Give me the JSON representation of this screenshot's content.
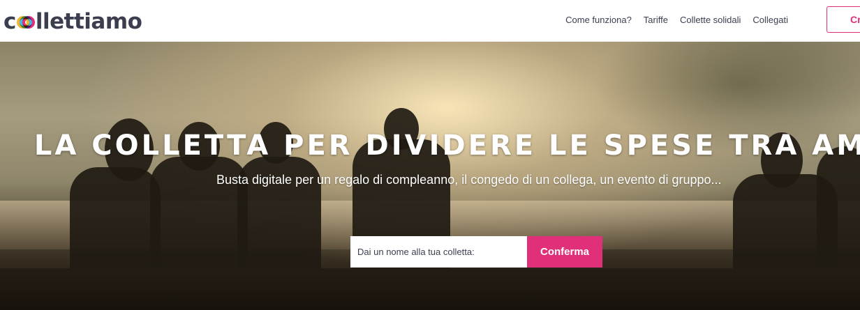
{
  "brand": {
    "logo_prefix": "c",
    "logo_suffix": "llettiamo",
    "accent_color": "#e0307a",
    "logo_ring_colors": [
      "#f2b632",
      "#e0307a",
      "#2ba6de"
    ]
  },
  "nav": {
    "items": [
      {
        "label": "Come funziona?"
      },
      {
        "label": "Tariffe"
      },
      {
        "label": "Collette solidali"
      },
      {
        "label": "Collegati"
      }
    ],
    "cta_label": "Crea"
  },
  "hero": {
    "title": "LA COLLETTA PER DIVIDERE LE SPESE TRA AMICI",
    "subtitle": "Busta digitale per un regalo di compleanno, il congedo di un collega, un evento di gruppo...",
    "input_placeholder": "Dai un nome alla tua colletta:",
    "confirm_label": "Conferma"
  }
}
